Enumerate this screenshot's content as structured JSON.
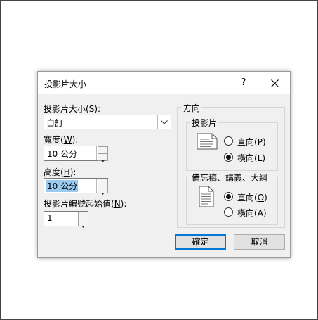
{
  "dialog": {
    "title": "投影片大小",
    "help_glyph": "?",
    "close_glyph": "✕"
  },
  "fields": {
    "size_label": "投影片大小(",
    "size_key": "S",
    "size_suffix": "):",
    "size_value": "自訂",
    "width_label": "寬度(",
    "width_key": "W",
    "width_suffix": "):",
    "width_value": "10 公分",
    "height_label": "高度(",
    "height_key": "H",
    "height_suffix": "):",
    "height_value": "10 公分",
    "number_label": "投影片編號起始值(",
    "number_key": "N",
    "number_suffix": "):",
    "number_value": "1"
  },
  "orientation": {
    "title": "方向",
    "slides_group": "投影片",
    "slides_portrait": "直向(",
    "slides_portrait_key": "P",
    "slides_landscape": "橫向(",
    "slides_landscape_key": "L",
    "slides_selected": "landscape",
    "notes_group": "備忘稿、講義、大綱",
    "notes_portrait": "直向(",
    "notes_portrait_key": "O",
    "notes_landscape": "橫向(",
    "notes_landscape_key": "A",
    "notes_selected": "portrait",
    "close_paren": ")"
  },
  "buttons": {
    "ok": "確定",
    "cancel": "取消"
  },
  "colors": {
    "dialog_bg": "#f0f0f0",
    "selection": "#99c9ef",
    "default_border": "#0078d7"
  }
}
